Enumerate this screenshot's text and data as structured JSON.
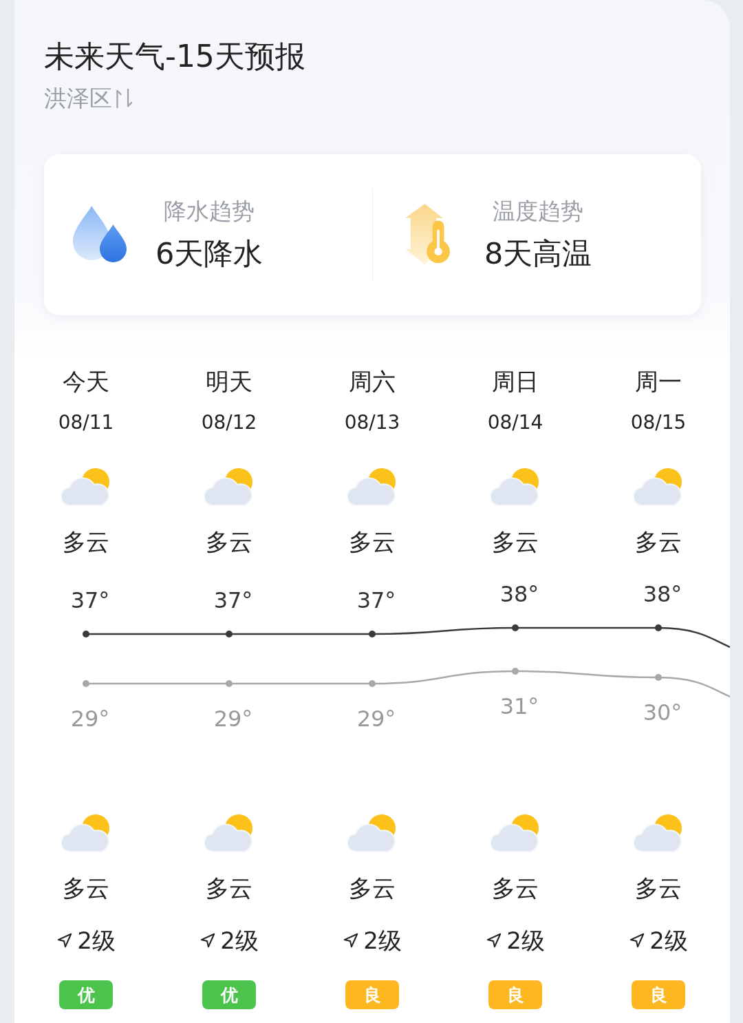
{
  "header": {
    "title": "未来天气-15天预报",
    "location": "洪泽区"
  },
  "trends": [
    {
      "kind": "rain",
      "label": "降水趋势",
      "value": "6天降水"
    },
    {
      "kind": "heat",
      "label": "温度趋势",
      "value": "8天高温"
    }
  ],
  "days": [
    {
      "name": "今天",
      "date": "08/11",
      "day_weather": "多云",
      "high": "37°",
      "low": "29°",
      "night_weather": "多云",
      "wind": "2级",
      "aqi": "优",
      "color": "#4cc34d"
    },
    {
      "name": "明天",
      "date": "08/12",
      "day_weather": "多云",
      "high": "37°",
      "low": "29°",
      "night_weather": "多云",
      "wind": "2级",
      "aqi": "优",
      "color": "#4cc34d"
    },
    {
      "name": "周六",
      "date": "08/13",
      "day_weather": "多云",
      "high": "37°",
      "low": "29°",
      "night_weather": "多云",
      "wind": "2级",
      "aqi": "良",
      "color": "#fdb821"
    },
    {
      "name": "周日",
      "date": "08/14",
      "day_weather": "多云",
      "high": "38°",
      "low": "31°",
      "night_weather": "多云",
      "wind": "2级",
      "aqi": "良",
      "color": "#fdb821"
    },
    {
      "name": "周一",
      "date": "08/15",
      "day_weather": "多云",
      "high": "38°",
      "low": "30°",
      "night_weather": "多云",
      "wind": "2级",
      "aqi": "良",
      "color": "#fdb821"
    }
  ]
}
